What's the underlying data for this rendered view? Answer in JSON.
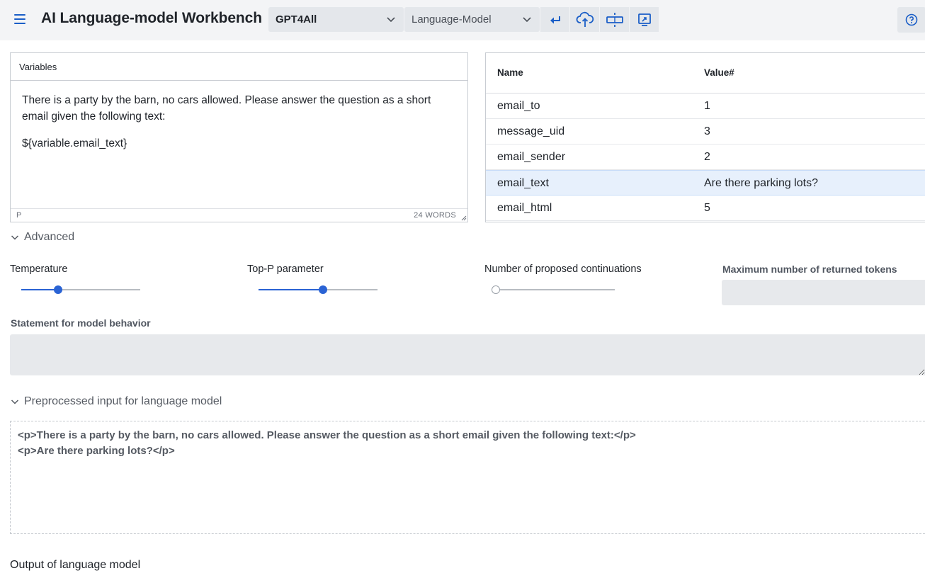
{
  "header": {
    "title": "AI Language-model Workbench",
    "model_select": {
      "value": "GPT4All"
    },
    "type_select": {
      "value": "Language-Model"
    },
    "toolbar": [
      {
        "icon": "enter-return-icon"
      },
      {
        "icon": "cloud-upload-icon"
      },
      {
        "icon": "split-horizontal-icon"
      },
      {
        "icon": "export-screen-icon"
      }
    ],
    "help_icon": "help-circle-icon"
  },
  "editor": {
    "label": "Variables",
    "paragraph1": "There is a party by the barn, no cars allowed. Please answer the question as a short email given the following text:",
    "paragraph2": "${variable.email_text}",
    "path": "P",
    "word_count": "24 WORDS"
  },
  "variables_table": {
    "headers": {
      "name": "Name",
      "value": "Value#"
    },
    "rows": [
      {
        "name": "email_to",
        "value": "1"
      },
      {
        "name": "message_uid",
        "value": "3"
      },
      {
        "name": "email_sender",
        "value": "2"
      },
      {
        "name": "email_text",
        "value": "Are there parking lots?",
        "selected": true
      },
      {
        "name": "email_html",
        "value": "5"
      }
    ]
  },
  "advanced": {
    "label": "Advanced",
    "temperature": {
      "label": "Temperature",
      "value_fraction": 0.31
    },
    "top_p": {
      "label": "Top-P parameter",
      "value_fraction": 0.54
    },
    "continuations": {
      "label": "Number of proposed continuations",
      "value_fraction": 0.0
    },
    "max_tokens": {
      "label": "Maximum number of returned tokens",
      "value": ""
    },
    "statement": {
      "label": "Statement for model behavior",
      "value": ""
    }
  },
  "preprocessed": {
    "label": "Preprocessed input for language model",
    "line1": "<p>There is a party by the barn, no cars allowed. Please answer the question as a short email given the following text:</p>",
    "line2": "<p>Are there parking lots?</p>"
  },
  "output": {
    "label": "Output of language model"
  },
  "colors": {
    "accent": "#2a63d4",
    "icon_blue": "#1a5ec7",
    "header_bg": "#f3f4f6",
    "selected_row": "#e7f0fc"
  }
}
